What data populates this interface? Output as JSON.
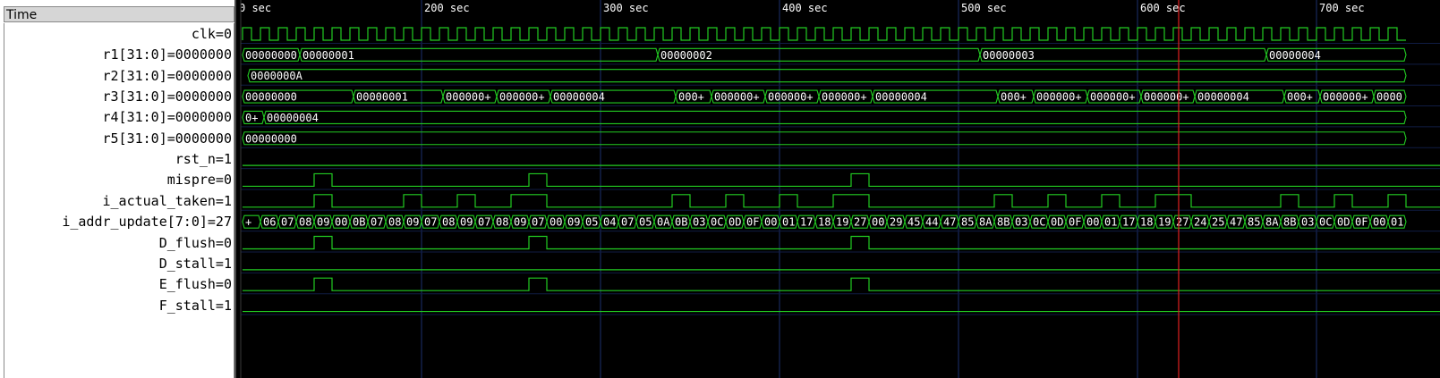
{
  "signal_panel": {
    "header": "Time",
    "signals": [
      {
        "name": "clk",
        "value": "0",
        "label": "clk=0"
      },
      {
        "name": "r1[31:0]",
        "value": "0000000",
        "label": "r1[31:0]=0000000"
      },
      {
        "name": "r2[31:0]",
        "value": "0000000",
        "label": "r2[31:0]=0000000"
      },
      {
        "name": "r3[31:0]",
        "value": "0000000",
        "label": "r3[31:0]=0000000"
      },
      {
        "name": "r4[31:0]",
        "value": "0000000",
        "label": "r4[31:0]=0000000"
      },
      {
        "name": "r5[31:0]",
        "value": "0000000",
        "label": "r5[31:0]=0000000"
      },
      {
        "name": "rst_n",
        "value": "1",
        "label": "rst_n=1"
      },
      {
        "name": "mispre",
        "value": "0",
        "label": "mispre=0"
      },
      {
        "name": "i_actual_taken",
        "value": "1",
        "label": "i_actual_taken=1"
      },
      {
        "name": "i_addr_update[7:0]",
        "value": "27",
        "label": "i_addr_update[7:0]=27"
      },
      {
        "name": "D_flush",
        "value": "0",
        "label": "D_flush=0"
      },
      {
        "name": "D_stall",
        "value": "1",
        "label": "D_stall=1"
      },
      {
        "name": "E_flush",
        "value": "0",
        "label": "E_flush=0"
      },
      {
        "name": "F_stall",
        "value": "1",
        "label": "F_stall=1"
      }
    ]
  },
  "timeline": {
    "unit": "sec",
    "ticks": [
      100,
      200,
      300,
      400,
      500,
      600,
      700
    ],
    "tick_labels": [
      "0 sec",
      "200 sec",
      "300 sec",
      "400 sec",
      "500 sec",
      "600 sec",
      "700 sec"
    ],
    "cursor_time": 623,
    "clk_period": 10
  },
  "waves": {
    "r1": [
      [
        "00000000",
        100,
        132
      ],
      [
        "00000001",
        132,
        332
      ],
      [
        "00000002",
        332,
        512
      ],
      [
        "00000003",
        512,
        672
      ],
      [
        "00000004",
        672,
        750
      ]
    ],
    "r2": [
      [
        "0000000A",
        103,
        750
      ]
    ],
    "r3": [
      [
        "00000000",
        100,
        162
      ],
      [
        "00000001",
        162,
        212
      ],
      [
        "000000+",
        212,
        242
      ],
      [
        "000000+",
        242,
        272
      ],
      [
        "00000004",
        272,
        342
      ],
      [
        "000+",
        342,
        362
      ],
      [
        "000000+",
        362,
        392
      ],
      [
        "000000+",
        392,
        422
      ],
      [
        "000000+",
        422,
        452
      ],
      [
        "00000004",
        452,
        522
      ],
      [
        "000+",
        522,
        542
      ],
      [
        "000000+",
        542,
        572
      ],
      [
        "000000+",
        572,
        602
      ],
      [
        "000000+",
        602,
        632
      ],
      [
        "00000004",
        632,
        682
      ],
      [
        "000+",
        682,
        702
      ],
      [
        "000000+",
        702,
        732
      ],
      [
        "0000",
        732,
        750
      ]
    ],
    "r4": [
      [
        "0+",
        100,
        112
      ],
      [
        "00000004",
        112,
        750
      ]
    ],
    "r5": [
      [
        "00000000",
        100,
        750
      ]
    ],
    "mispre": [
      [
        140,
        150
      ],
      [
        260,
        270
      ],
      [
        440,
        450
      ]
    ],
    "i_actual_taken": [
      [
        140,
        150
      ],
      [
        190,
        200
      ],
      [
        220,
        230
      ],
      [
        250,
        270
      ],
      [
        340,
        350
      ],
      [
        370,
        380
      ],
      [
        400,
        410
      ],
      [
        430,
        450
      ],
      [
        520,
        530
      ],
      [
        550,
        560
      ],
      [
        580,
        590
      ],
      [
        610,
        630
      ],
      [
        680,
        690
      ],
      [
        710,
        720
      ],
      [
        740,
        750
      ]
    ],
    "i_addr_update": [
      "+",
      "06",
      "07",
      "08",
      "09",
      "00",
      "0B",
      "07",
      "08",
      "09",
      "07",
      "08",
      "09",
      "07",
      "08",
      "09",
      "07",
      "00",
      "09",
      "05",
      "04",
      "07",
      "05",
      "0A",
      "0B",
      "03",
      "0C",
      "0D",
      "0F",
      "00",
      "01",
      "17",
      "18",
      "19",
      "27",
      "00",
      "29",
      "45",
      "44",
      "47",
      "85",
      "8A",
      "8B",
      "03",
      "0C",
      "0D",
      "0F",
      "00",
      "01",
      "17",
      "18",
      "19",
      "27",
      "24",
      "25",
      "47",
      "85",
      "8A",
      "8B",
      "03",
      "0C",
      "0D",
      "0F",
      "00",
      "01"
    ],
    "D_flush": [
      [
        140,
        150
      ],
      [
        260,
        270
      ],
      [
        440,
        450
      ]
    ],
    "E_flush": [
      [
        140,
        150
      ],
      [
        260,
        270
      ],
      [
        440,
        450
      ]
    ]
  },
  "colors": {
    "wave": "#22cc22",
    "grid": "#1b2f6e",
    "cursor": "#e02020",
    "background": "#000000",
    "text": "#ffffff"
  }
}
